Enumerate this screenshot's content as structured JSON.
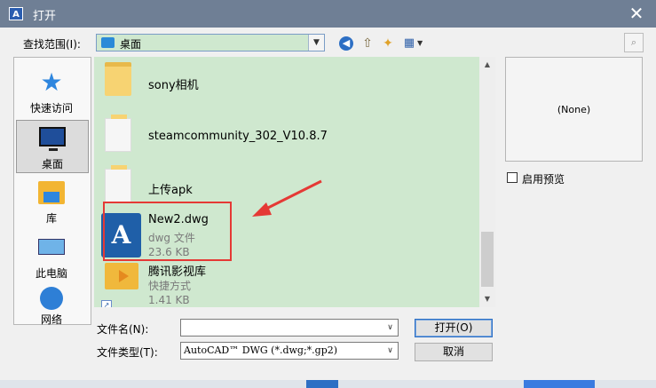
{
  "window": {
    "title": "打开",
    "app_icon": "A",
    "close_glyph": "✕"
  },
  "toolbar": {
    "look_in_label": "查找范围(I):",
    "look_in_value": "桌面",
    "icons": [
      "back-icon",
      "up-folder-icon",
      "new-folder-icon",
      "view-menu-icon",
      "tools-icon"
    ]
  },
  "places": [
    {
      "label": "快速访问",
      "icon": "star-icon"
    },
    {
      "label": "桌面",
      "icon": "desktop-icon",
      "active": true
    },
    {
      "label": "库",
      "icon": "library-icon"
    },
    {
      "label": "此电脑",
      "icon": "computer-icon"
    },
    {
      "label": "网络",
      "icon": "network-icon"
    }
  ],
  "files": [
    {
      "name": "sony相机",
      "kind": "folder"
    },
    {
      "name": "steamcommunity_302_V10.8.7",
      "kind": "folder"
    },
    {
      "name": "上传apk",
      "kind": "folder"
    },
    {
      "name": "New2.dwg",
      "type": "dwg 文件",
      "size": "23.6 KB",
      "kind": "dwg",
      "highlighted": true
    },
    {
      "name": "腾讯影视库",
      "type": "快捷方式",
      "size": "1.41 KB",
      "kind": "shortcut"
    }
  ],
  "preview": {
    "text": "(None)",
    "checkbox_label": "启用预览"
  },
  "form": {
    "filename_label": "文件名(N):",
    "filename_value": "",
    "filetype_label": "文件类型(T):",
    "filetype_value": "AutoCAD™ DWG (*.dwg;*.gp2)"
  },
  "buttons": {
    "open": "打开(O)",
    "cancel": "取消"
  },
  "colors": {
    "list_background": "#cfe8cf",
    "highlight": "#e53935",
    "titlebar": "#6f7f95"
  }
}
